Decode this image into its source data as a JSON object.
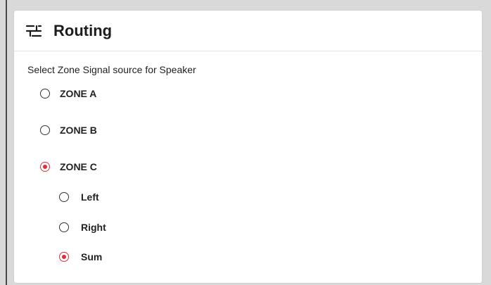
{
  "panel": {
    "title": "Routing",
    "icon": "routing-icon",
    "instruction": "Select Zone Signal source for Speaker"
  },
  "zone_options": [
    {
      "label": "ZONE A",
      "selected": false
    },
    {
      "label": "ZONE B",
      "selected": false
    },
    {
      "label": "ZONE C",
      "selected": true
    }
  ],
  "channel_options": [
    {
      "label": "Left",
      "selected": false
    },
    {
      "label": "Right",
      "selected": false
    },
    {
      "label": "Sum",
      "selected": true
    }
  ],
  "colors": {
    "accent": "#e02b3c",
    "background": "#d9d9d9",
    "card": "#ffffff"
  }
}
